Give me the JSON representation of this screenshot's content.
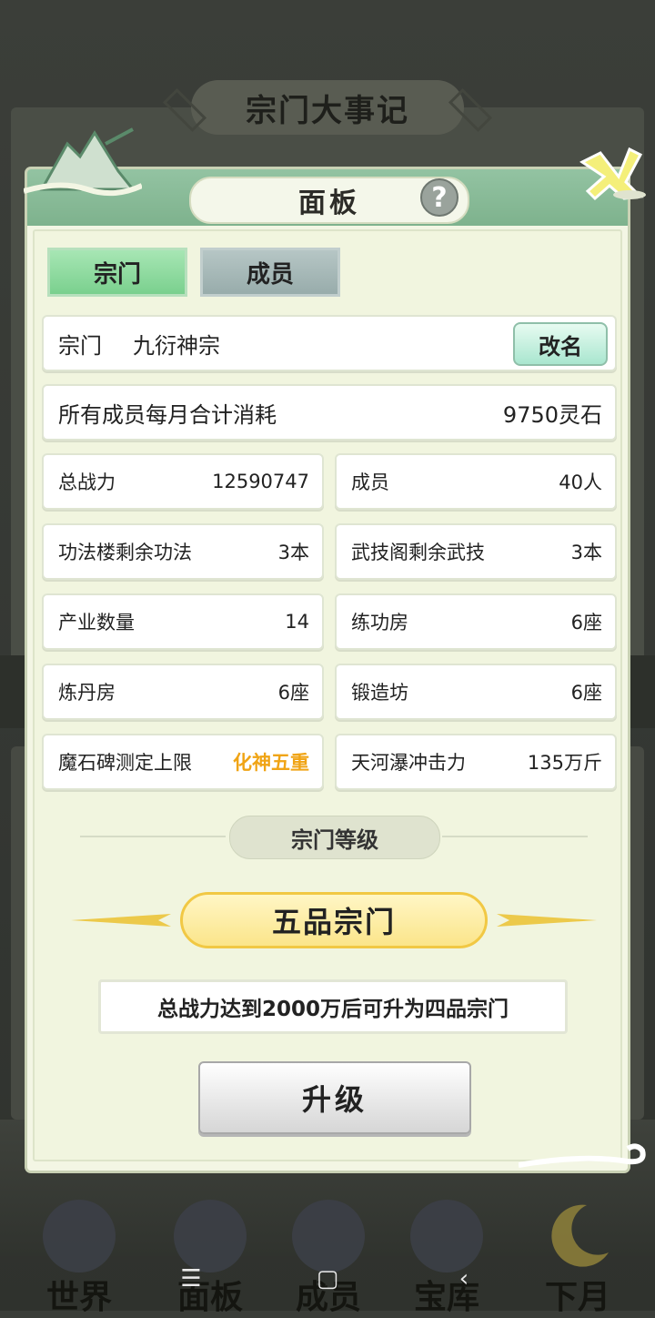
{
  "background": {
    "title": "宗门大事记"
  },
  "modal": {
    "title": "面板",
    "help_label": "?",
    "tabs": [
      {
        "label": "宗门",
        "active": true
      },
      {
        "label": "成员",
        "active": false
      }
    ],
    "sect": {
      "label": "宗门",
      "name": "九衍神宗",
      "rename_label": "改名"
    },
    "monthly_cost": {
      "label": "所有成员每月合计消耗",
      "value": "9750灵石"
    },
    "stats": [
      {
        "label": "总战力",
        "value": "12590747"
      },
      {
        "label": "成员",
        "value": "40人"
      },
      {
        "label": "功法楼剩余功法",
        "value": "3本"
      },
      {
        "label": "武技阁剩余武技",
        "value": "3本"
      },
      {
        "label": "产业数量",
        "value": "14"
      },
      {
        "label": "练功房",
        "value": "6座"
      },
      {
        "label": "炼丹房",
        "value": "6座"
      },
      {
        "label": "锻造坊",
        "value": "6座"
      },
      {
        "label": "魔石碑测定上限",
        "value": "化神五重",
        "highlight": true
      },
      {
        "label": "天河瀑冲击力",
        "value": "135万斤"
      }
    ],
    "grade_header": "宗门等级",
    "grade": "五品宗门",
    "requirement": "总战力达到2000万后可升为四品宗门",
    "upgrade_label": "升级",
    "highlight_color": "#f0a415"
  },
  "bottom_nav": [
    {
      "label": "世界",
      "icon": "world-icon"
    },
    {
      "label": "面板",
      "icon": "panel-icon"
    },
    {
      "label": "成员",
      "icon": "member-icon"
    },
    {
      "label": "宝库",
      "icon": "treasury-icon"
    },
    {
      "label": "下月",
      "icon": "moon-icon"
    }
  ],
  "system_bar": {
    "menu": "☰",
    "home": "▢",
    "back": "‹"
  }
}
